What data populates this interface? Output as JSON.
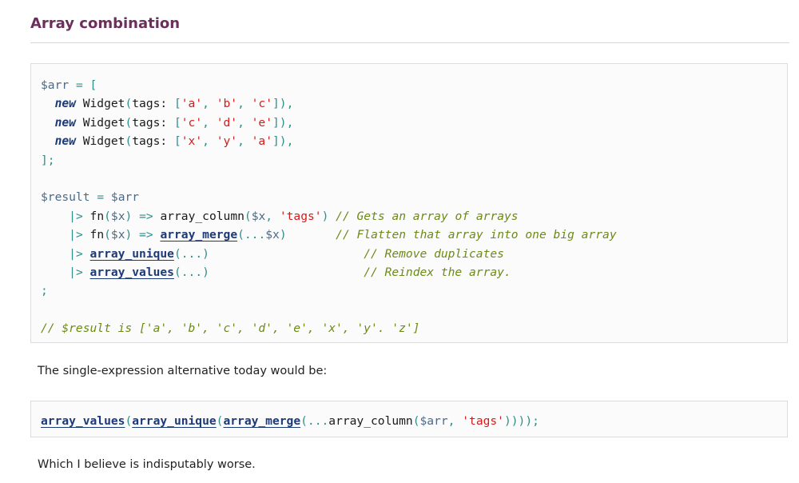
{
  "section": {
    "heading": "Array combination"
  },
  "code_block_1": {
    "arr_var": "$arr",
    "eq": "=",
    "open_bracket": "[",
    "items": [
      {
        "kw": "new",
        "cls": " Widget",
        "open": "(",
        "param": "tags: ",
        "lb": "[",
        "a": "'a'",
        "b": "'b'",
        "c": "'c'",
        "close": "]),"
      },
      {
        "kw": "new",
        "cls": " Widget",
        "open": "(",
        "param": "tags: ",
        "lb": "[",
        "a": "'c'",
        "b": "'d'",
        "c": "'e'",
        "close": "]),"
      },
      {
        "kw": "new",
        "cls": " Widget",
        "open": "(",
        "param": "tags: ",
        "lb": "[",
        "a": "'x'",
        "b": "'y'",
        "c": "'a'",
        "close": "]),"
      }
    ],
    "close_bracket": "];",
    "result_var": "$result",
    "pipe_lines": [
      {
        "pipe": "|>",
        "fn": "fn",
        "p1": "(",
        "var": "$x",
        "p2": ")",
        "arrow": "=>",
        "call": "array_column",
        "p3": "(",
        "var2": "$x",
        "sep": ", ",
        "str": "'tags'",
        "p4": ")",
        "comment": "// Gets an array of arrays"
      },
      {
        "pipe": "|>",
        "fn": "fn",
        "p1": "(",
        "var": "$x",
        "p2": ")",
        "arrow": "=>",
        "call": "array_merge",
        "p3": "(...",
        "var2": "$x",
        "p4": ")",
        "comment": "// Flatten that array into one big array"
      },
      {
        "pipe": "|>",
        "call": "array_unique",
        "args": "(...)",
        "comment": "// Remove duplicates"
      },
      {
        "pipe": "|>",
        "call": "array_values",
        "args": "(...)",
        "comment": "// Reindex the array."
      }
    ],
    "semicolon": ";",
    "final_comment": "// $result is ['a', 'b', 'c', 'd', 'e', 'x', 'y'. 'z']"
  },
  "paragraph_1": "The single-expression alternative today would be:",
  "code_block_2": {
    "f1": "array_values",
    "f2": "array_unique",
    "f3": "array_merge",
    "spread": "...",
    "f4": "array_column",
    "var": "$arr",
    "sep": ", ",
    "str": "'tags'",
    "tail": "))));"
  },
  "paragraph_2": "Which I believe is indisputably worse."
}
